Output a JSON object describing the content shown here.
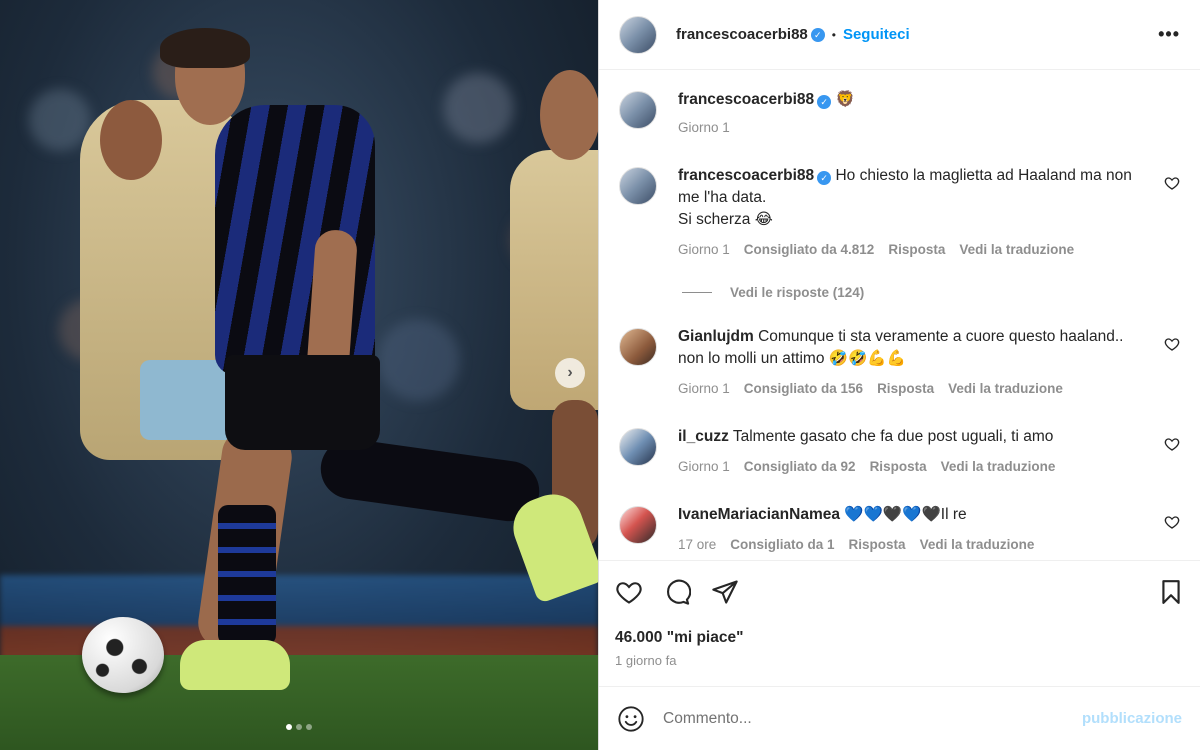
{
  "post": {
    "author": "francescoacerbi88",
    "follow_label": "Seguiteci",
    "separator": "•",
    "more_label": "•••",
    "verified_mark": "✓"
  },
  "caption": {
    "username": "francescoacerbi88",
    "text": "🦁",
    "time": "Giorno 1"
  },
  "comments": [
    {
      "username": "francescoacerbi88",
      "line1": "Ho chiesto la maglietta ad Haaland ma non me l'ha data.",
      "line2": "Si scherza 😂",
      "time": "Giorno 1",
      "likes": "Consigliato da 4.812",
      "reply": "Risposta",
      "translate": "Vedi la traduzione"
    },
    {
      "username": "Gianlujdm",
      "line1": "Comunque ti sta veramente a cuore questo haaland.. non lo molli un attimo 🤣🤣💪💪",
      "time": "Giorno 1",
      "likes": "Consigliato da 156",
      "reply": "Risposta",
      "translate": "Vedi la traduzione"
    },
    {
      "username": "il_cuzz",
      "line1": "Talmente gasato che fa due post uguali, ti amo",
      "time": "Giorno 1",
      "likes": "Consigliato da 92",
      "reply": "Risposta",
      "translate": "Vedi la traduzione"
    },
    {
      "username": "IvaneMariacianNamea",
      "line1": "💙💙🖤💙🖤Il re",
      "time": "17 ore",
      "likes": "Consigliato da 1",
      "reply": "Risposta",
      "translate": "Vedi la traduzione"
    }
  ],
  "view_replies": "Vedi le risposte (124)",
  "next_arrow": "›",
  "actions": {
    "likes_count": "46.000 \"mi piace\"",
    "date": "1 giorno fa"
  },
  "composer": {
    "placeholder": "Commento...",
    "publish": "pubblicazione"
  },
  "carousel": {
    "total": 3,
    "active": 1
  },
  "colors": {
    "accent": "#0095f6",
    "verified": "#3897f0",
    "muted": "#8e8e8e"
  }
}
